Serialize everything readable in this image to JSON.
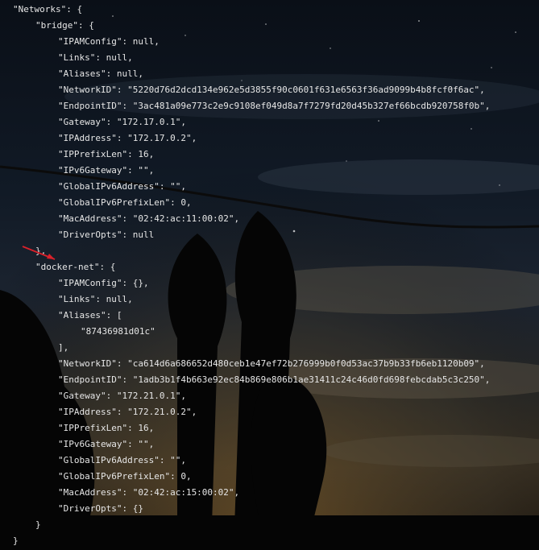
{
  "colors": {
    "text": "#e6e6e6",
    "annotation_arrow": "#d9212b",
    "sky_top": "#0a0f17",
    "horizon_glow": "#3a3124"
  },
  "icons": {
    "annotation": "red-arrow-icon"
  },
  "code_lines": [
    {
      "indent": 0,
      "text": "\"Networks\": {"
    },
    {
      "indent": 1,
      "text": "\"bridge\": {"
    },
    {
      "indent": 2,
      "text": "\"IPAMConfig\": null,"
    },
    {
      "indent": 2,
      "text": "\"Links\": null,"
    },
    {
      "indent": 2,
      "text": "\"Aliases\": null,"
    },
    {
      "indent": 2,
      "text": "\"NetworkID\": \"5220d76d2dcd134e962e5d3855f90c0601f631e6563f36ad9099b4b8fcf0f6ac\","
    },
    {
      "indent": 2,
      "text": "\"EndpointID\": \"3ac481a09e773c2e9c9108ef049d8a7f7279fd20d45b327ef66bcdb920758f0b\","
    },
    {
      "indent": 2,
      "text": "\"Gateway\": \"172.17.0.1\","
    },
    {
      "indent": 2,
      "text": "\"IPAddress\": \"172.17.0.2\","
    },
    {
      "indent": 2,
      "text": "\"IPPrefixLen\": 16,"
    },
    {
      "indent": 2,
      "text": "\"IPv6Gateway\": \"\","
    },
    {
      "indent": 2,
      "text": "\"GlobalIPv6Address\": \"\","
    },
    {
      "indent": 2,
      "text": "\"GlobalIPv6PrefixLen\": 0,"
    },
    {
      "indent": 2,
      "text": "\"MacAddress\": \"02:42:ac:11:00:02\","
    },
    {
      "indent": 2,
      "text": "\"DriverOpts\": null"
    },
    {
      "indent": 1,
      "text": "},"
    },
    {
      "indent": 1,
      "text": "\"docker-net\": {"
    },
    {
      "indent": 2,
      "text": "\"IPAMConfig\": {},"
    },
    {
      "indent": 2,
      "text": "\"Links\": null,"
    },
    {
      "indent": 2,
      "text": "\"Aliases\": ["
    },
    {
      "indent": 3,
      "text": "\"87436981d01c\""
    },
    {
      "indent": 2,
      "text": "],"
    },
    {
      "indent": 2,
      "text": "\"NetworkID\": \"ca614d6a686652d480ceb1e47ef72b276999b0f0d53ac37b9b33fb6eb1120b09\","
    },
    {
      "indent": 2,
      "text": "\"EndpointID\": \"1adb3b1f4b663e92ec84b869e806b1ae31411c24c46d0fd698febcdab5c3c250\","
    },
    {
      "indent": 2,
      "text": "\"Gateway\": \"172.21.0.1\","
    },
    {
      "indent": 2,
      "text": "\"IPAddress\": \"172.21.0.2\","
    },
    {
      "indent": 2,
      "text": "\"IPPrefixLen\": 16,"
    },
    {
      "indent": 2,
      "text": "\"IPv6Gateway\": \"\","
    },
    {
      "indent": 2,
      "text": "\"GlobalIPv6Address\": \"\","
    },
    {
      "indent": 2,
      "text": "\"GlobalIPv6PrefixLen\": 0,"
    },
    {
      "indent": 2,
      "text": "\"MacAddress\": \"02:42:ac:15:00:02\","
    },
    {
      "indent": 2,
      "text": "\"DriverOpts\": {}"
    },
    {
      "indent": 1,
      "text": "}"
    },
    {
      "indent": 0,
      "text": "}"
    }
  ]
}
